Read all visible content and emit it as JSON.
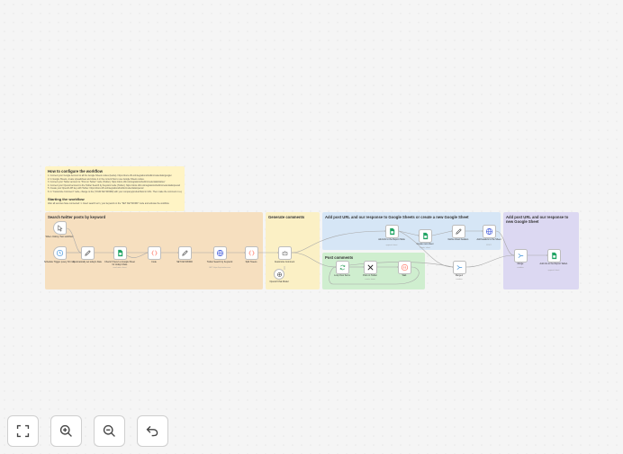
{
  "note": {
    "title": "How to configure the workflow",
    "lines": [
      "1. Connect your Google Account to all the Google Sheets nodes (below). https://docs.n8n.io/integrations/builtin/credentials/google/",
      "2. In Google Sheets, create spreadsheet and share it or the current flow to use Google Sheets nodes.",
      "3. Connect your Twitter account to \"Post on Twitter\" node (Twitter). https://docs.n8n.io/integrations/builtin/credentials/twitter/",
      "4. Connect your OpenAI account to the Twitter Search by Keyword node (Twitter). https://docs.n8n.io/integrations/builtin/credentials/openai/",
      "5. Create your OpenAI API key with Twitter. https://docs.n8n.io/integrations/builtin/credentials/openai/",
      "6. In \"Customize Comment\" node, change to the [YOUR KEYWORD] with your company/product/field in URL. Then make the comment in a personal tone."
    ],
    "start_title": "Starting the workflow",
    "start_line": "After all services have connected: 1. Insert search term, your keyword on the \"SET KEYWORD\" node and activate the workflow."
  },
  "sections": {
    "search": "Search twitter posts by keyword",
    "generate": "Generate comments",
    "add1": "Add post URL and our response to Google Sheets or create a new Google Sheet",
    "post": "Post comments",
    "add2": "Add post URL and our response to new Google Sheet"
  },
  "nodes": {
    "webhook": {
      "label": "When clicking 'Test workflow'"
    },
    "schedule": {
      "label": "Schedule Trigger (every 30 min)"
    },
    "sheetdate": {
      "label": "Automatically set today's Date"
    },
    "checksheet": {
      "label": "Check if there's a Google Sheet for today's Date",
      "sub": "read rows: sheet"
    },
    "code": {
      "label": "Code"
    },
    "setkeyword": {
      "label": "SET KEYWORD"
    },
    "twsearch": {
      "label": "Twitter Search by Keyword",
      "sub": "GET: https://api.twitter.com"
    },
    "split": {
      "label": "Split Tweets"
    },
    "customize": {
      "label": "Customize Comment"
    },
    "openai": {
      "label": "OpenAI Chat Model"
    },
    "addinfo": {
      "label": "Add info to the Report Table",
      "sub": "append: sheet"
    },
    "createsheet": {
      "label": "Create new sheet",
      "sub": "create: sheet"
    },
    "define": {
      "label": "Define sheet headers"
    },
    "addheaders": {
      "label": "Add headers to the Sheet",
      "sub": "POST"
    },
    "loop": {
      "label": "Loop Over Items"
    },
    "twpost": {
      "label": "Post on Twitter",
      "sub": "create: tweet"
    },
    "wait": {
      "label": "Wait"
    },
    "merge": {
      "label": "Merge1",
      "sub": "combine"
    },
    "merge2": {
      "label": "Merge",
      "sub": "combine"
    },
    "addinfo2": {
      "label": "Add info to the Report Table1",
      "sub": "append: sheet"
    }
  },
  "colors": {
    "note": "#fff4c5",
    "search": "#f6dfbf",
    "generate": "#fbf0c5",
    "add1": "#d6e6f6",
    "post": "#cfeecf",
    "add2": "#dcd8f2",
    "sheets": "#1fa463",
    "code": "#ff6d5a",
    "edit": "#444444",
    "http": "#3b55d9"
  },
  "controls": {
    "fit": "fit-view-icon",
    "zoomin": "zoom-in-icon",
    "zoomout": "zoom-out-icon",
    "undo": "undo-icon"
  }
}
